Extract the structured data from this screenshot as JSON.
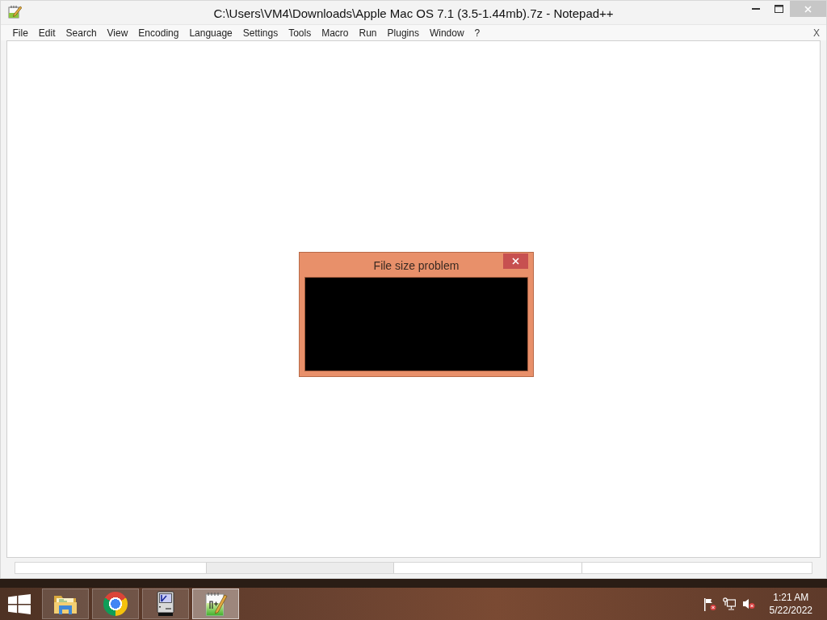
{
  "window": {
    "title": "C:\\Users\\VM4\\Downloads\\Apple Mac OS 7.1 (3.5-1.44mb).7z - Notepad++"
  },
  "menu": {
    "items": [
      "File",
      "Edit",
      "Search",
      "View",
      "Encoding",
      "Language",
      "Settings",
      "Tools",
      "Macro",
      "Run",
      "Plugins",
      "Window",
      "?"
    ],
    "close_document": "X"
  },
  "dialog": {
    "title": "File size problem"
  },
  "taskbar": {
    "apps": [
      {
        "kind": "folder",
        "selected": false
      },
      {
        "kind": "browser",
        "selected": false
      },
      {
        "kind": "computer",
        "selected": false
      },
      {
        "kind": "notepad",
        "selected": true
      }
    ],
    "clock": {
      "time": "1:21 AM",
      "date": "5/22/2022"
    }
  }
}
